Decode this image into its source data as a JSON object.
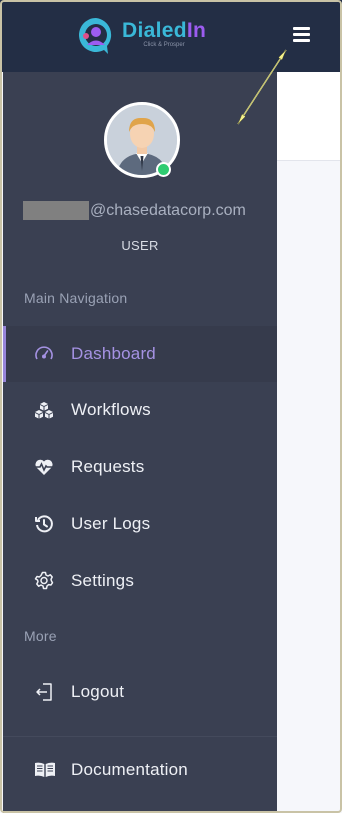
{
  "app": {
    "name_part1": "Dialed",
    "name_part2": "In",
    "tagline": "Click & Prosper"
  },
  "topbar": {
    "menu_icon": "hamburger-icon"
  },
  "user": {
    "email_visible": "@chasedatacorp.com",
    "role": "USER",
    "status_color": "#2ecc71"
  },
  "sidebar": {
    "main_section": "Main Navigation",
    "more_section": "More",
    "items": [
      {
        "label": "Dashboard",
        "icon": "gauge-icon",
        "active": true
      },
      {
        "label": "Workflows",
        "icon": "cubes-icon",
        "active": false
      },
      {
        "label": "Requests",
        "icon": "heartbeat-icon",
        "active": false
      },
      {
        "label": "User Logs",
        "icon": "history-icon",
        "active": false
      },
      {
        "label": "Settings",
        "icon": "gear-icon",
        "active": false
      }
    ],
    "more_items": [
      {
        "label": "Logout",
        "icon": "logout-icon"
      },
      {
        "label": "Documentation",
        "icon": "book-icon"
      }
    ]
  },
  "colors": {
    "topbar": "#232e45",
    "sidebar": "#3a4052",
    "accent": "#9785d9"
  }
}
